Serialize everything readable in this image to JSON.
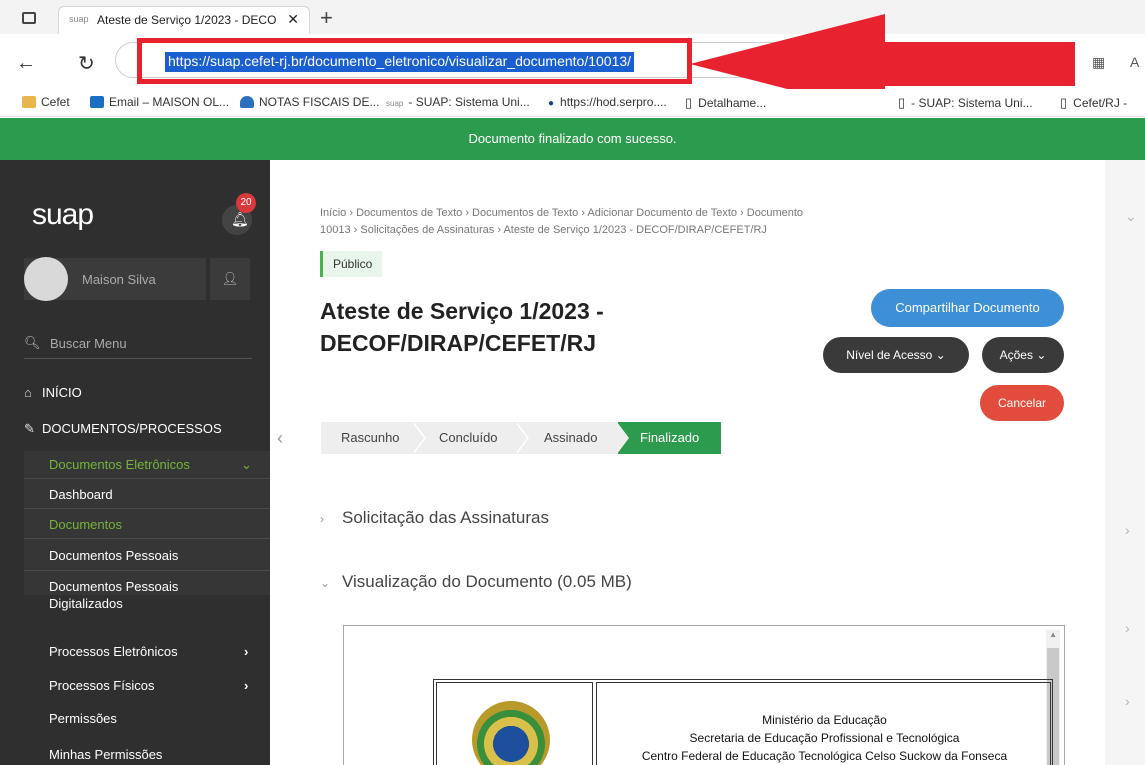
{
  "browser": {
    "tab_favicon": "suap",
    "tab_title": "Ateste de Serviço 1/2023 - DECO",
    "url": "https://suap.cefet-rj.br/documento_eletronico/visualizar_documento/10013/",
    "addr_right_text": "A",
    "bookmarks": [
      {
        "label": "Cefet",
        "icon": "folder-icon"
      },
      {
        "label": "Email – MAISON OL...",
        "icon": "outlook-icon"
      },
      {
        "label": "NOTAS FISCAIS DE...",
        "icon": "cloud-icon"
      },
      {
        "label": "- SUAP: Sistema Uni...",
        "icon": "suap-icon",
        "prefix": "suap"
      },
      {
        "label": "https://hod.serpro....",
        "icon": "globe-icon"
      },
      {
        "label": "Detalhame...",
        "icon": "page-icon"
      },
      {
        "label": "- SUAP: Sistema Uni...",
        "icon": "page-icon"
      },
      {
        "label": "Cefet/RJ -",
        "icon": "page-icon"
      }
    ]
  },
  "banner": {
    "message": "Documento finalizado com sucesso.",
    "color": "#2d9b4e"
  },
  "sidebar": {
    "logo": "suap",
    "notification_count": "20",
    "user_name": "Maison Silva",
    "search_label": "Buscar Menu",
    "sections": [
      {
        "label": "INÍCIO",
        "icon": "home-icon"
      },
      {
        "label": "DOCUMENTOS/PROCESSOS",
        "icon": "document-edit-icon"
      }
    ],
    "submenu_header": "Documentos Eletrônicos",
    "submenu_items": [
      {
        "label": "Dashboard",
        "active": false
      },
      {
        "label": "Documentos",
        "active": true
      },
      {
        "label": "Documentos Pessoais",
        "active": false
      },
      {
        "label": "Documentos Pessoais",
        "label_line2": "Digitalizados",
        "active": false
      }
    ],
    "more_items": [
      {
        "label": "Processos Eletrônicos",
        "has_children": true
      },
      {
        "label": "Processos Físicos",
        "has_children": true
      },
      {
        "label": "Permissões",
        "has_children": false
      },
      {
        "label": "Minhas Permissões",
        "has_children": false
      }
    ],
    "accent_color": "#75b33b"
  },
  "main": {
    "breadcrumb": {
      "line1": "Início › Documentos de Texto › Documentos de Texto › Adicionar Documento de Texto › Documento",
      "line2": "10013 › Solicitações de Assinaturas › Ateste de Serviço 1/2023 - DECOF/DIRAP/CEFET/RJ"
    },
    "access_badge": "Público",
    "title_line1": "Ateste de Serviço 1/2023 -",
    "title_line2": "DECOF/DIRAP/CEFET/RJ",
    "buttons": {
      "share": "Compartilhar Documento",
      "access": "Nível de Acesso",
      "actions": "Ações",
      "cancel": "Cancelar"
    },
    "steps": [
      "Rascunho",
      "Concluído",
      "Assinado",
      "Finalizado"
    ],
    "active_step": "Finalizado",
    "sections": {
      "signatures": "Solicitação das Assinaturas",
      "preview": "Visualização do Documento (0.05 MB)"
    },
    "document_header": {
      "line1": "Ministério da Educação",
      "line2": "Secretaria de Educação Profissional e Tecnológica",
      "line3": "Centro Federal de Educação Tecnológica Celso Suckow da Fonseca"
    }
  }
}
